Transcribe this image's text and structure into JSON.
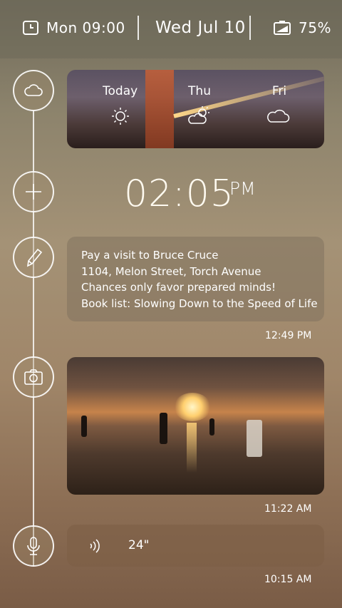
{
  "status_bar": {
    "alarm": "Mon 09:00",
    "date": "Wed Jul 10",
    "battery": "75%"
  },
  "weather": {
    "days": [
      {
        "label": "Today",
        "icon": "sun-icon"
      },
      {
        "label": "Thu",
        "icon": "partly-cloudy-icon"
      },
      {
        "label": "Fri",
        "icon": "cloud-icon"
      }
    ]
  },
  "clock": {
    "time": "02:05",
    "period": "PM"
  },
  "note": {
    "lines": [
      "Pay a visit to Bruce Cruce",
      "1104,  Melon Street, Torch Avenue",
      "Chances only favor prepared minds!",
      "Book list: Slowing Down to the Speed of Life"
    ],
    "time": "12:49 PM"
  },
  "photo": {
    "time": "11:22 AM"
  },
  "audio": {
    "duration": "24\"",
    "time": "10:15 AM"
  },
  "timeline_icons": [
    "cloud-icon",
    "plus-icon",
    "pencil-icon",
    "camera-icon",
    "microphone-icon"
  ]
}
